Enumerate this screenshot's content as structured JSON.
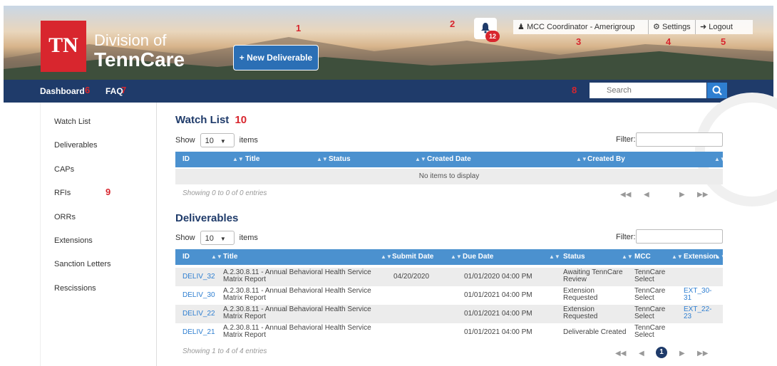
{
  "header": {
    "logo_mark": "TN",
    "logo_line1": "Division of",
    "logo_line2": "TennCare",
    "new_deliverable": "+ New Deliverable",
    "bell_count": "12",
    "user": "MCC Coordinator - Amerigroup",
    "settings": "Settings",
    "logout": "Logout"
  },
  "nav": {
    "dashboard": "Dashboard",
    "faq": "FAQ",
    "search_placeholder": "Search"
  },
  "annotations": [
    "1",
    "2",
    "3",
    "4",
    "5",
    "6",
    "7",
    "8",
    "9",
    "10"
  ],
  "sidebar": {
    "items": [
      "Watch List",
      "Deliverables",
      "CAPs",
      "RFIs",
      "ORRs",
      "Extensions",
      "Sanction Letters",
      "Rescissions"
    ]
  },
  "watchlist": {
    "title": "Watch List",
    "show": "Show",
    "page_size": "10",
    "items": "items",
    "filter": "Filter:",
    "columns": [
      "ID",
      "Title",
      "Status",
      "Created Date",
      "Created By"
    ],
    "empty": "No items to display",
    "showing": "Showing 0 to 0 of 0 entries"
  },
  "deliverables": {
    "title": "Deliverables",
    "show": "Show",
    "page_size": "10",
    "items": "items",
    "filter": "Filter:",
    "columns": [
      "ID",
      "Title",
      "Submit Date",
      "Due Date",
      "Status",
      "MCC",
      "Extension"
    ],
    "rows": [
      {
        "id": "DELIV_32",
        "title1": "A.2.30.8.11 - Annual Behavioral Health Service",
        "title2": "Matrix Report",
        "submit": "04/20/2020",
        "due": "01/01/2020 04:00 PM",
        "status1": "Awaiting TennCare",
        "status2": "Review",
        "mcc1": "TennCare",
        "mcc2": "Select",
        "ext1": "",
        "ext2": ""
      },
      {
        "id": "DELIV_30",
        "title1": "A.2.30.8.11 - Annual Behavioral Health Service",
        "title2": "Matrix Report",
        "submit": "",
        "due": "01/01/2021 04:00 PM",
        "status1": "Extension",
        "status2": "Requested",
        "mcc1": "TennCare",
        "mcc2": "Select",
        "ext1": "EXT_30-",
        "ext2": "31"
      },
      {
        "id": "DELIV_22",
        "title1": "A.2.30.8.11 - Annual Behavioral Health Service",
        "title2": "Matrix Report",
        "submit": "",
        "due": "01/01/2021 04:00 PM",
        "status1": "Extension",
        "status2": "Requested",
        "mcc1": "TennCare",
        "mcc2": "Select",
        "ext1": "EXT_22-",
        "ext2": "23"
      },
      {
        "id": "DELIV_21",
        "title1": "A.2.30.8.11 - Annual Behavioral Health Service",
        "title2": "Matrix Report",
        "submit": "",
        "due": "01/01/2021 04:00 PM",
        "status1": "Deliverable Created",
        "status2": "",
        "mcc1": "TennCare",
        "mcc2": "Select",
        "ext1": "",
        "ext2": ""
      }
    ],
    "showing": "Showing 1 to 4 of 4 entries",
    "current_page": "1"
  },
  "colors": {
    "nav": "#1f3b6a",
    "table_header": "#4b91cf",
    "accent_red": "#d8262e",
    "link": "#2f7fd1"
  }
}
